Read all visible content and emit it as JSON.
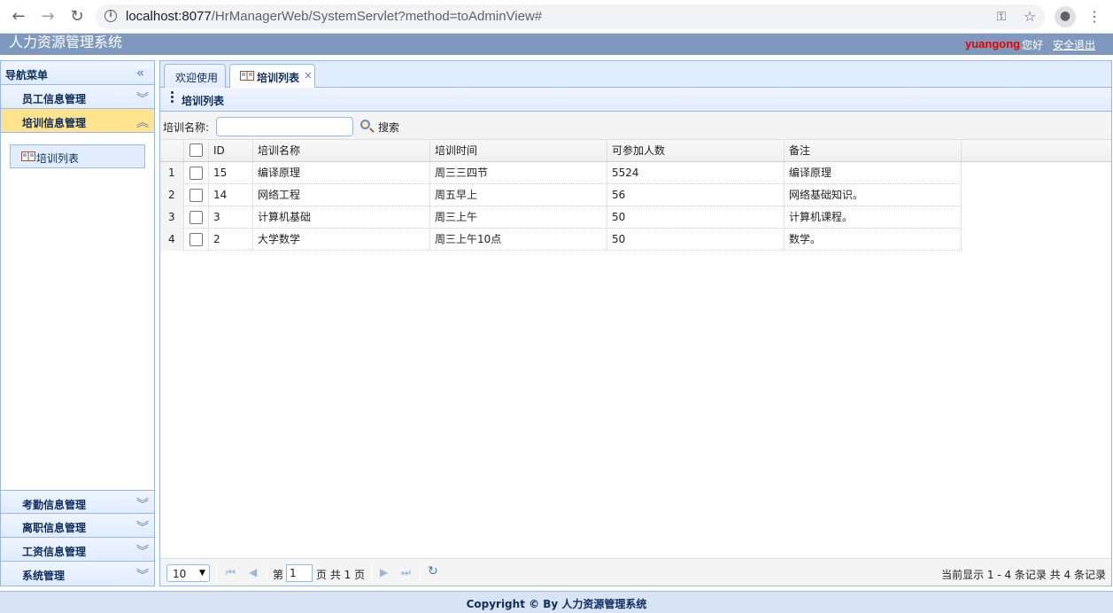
{
  "browser": {
    "url_host": "localhost:8077",
    "url_path": "/HrManagerWeb/SystemServlet?method=toAdminView#"
  },
  "app": {
    "title": "人力资源管理系统",
    "username": "yuangong",
    "greeting": "您好",
    "logout": "安全退出"
  },
  "sidebar": {
    "title": "导航菜单",
    "sections": [
      {
        "label": "员工信息管理",
        "active": false
      },
      {
        "label": "培训信息管理",
        "active": true
      },
      {
        "label": "考勤信息管理",
        "active": false
      },
      {
        "label": "离职信息管理",
        "active": false
      },
      {
        "label": "工资信息管理",
        "active": false
      },
      {
        "label": "系统管理",
        "active": false
      }
    ],
    "active_link": "培训列表"
  },
  "tabs": [
    {
      "label": "欢迎使用",
      "selected": false
    },
    {
      "label": "培训列表",
      "selected": true
    }
  ],
  "panel": {
    "title": "培训列表",
    "search_label": "培训名称:",
    "search_value": "",
    "search_button": "搜索"
  },
  "grid": {
    "columns": [
      "ID",
      "培训名称",
      "培训时间",
      "可参加人数",
      "备注"
    ],
    "rows": [
      {
        "rn": "1",
        "id": "15",
        "name": "编译原理",
        "time": "周三三四节",
        "count": "5524",
        "note": "编译原理"
      },
      {
        "rn": "2",
        "id": "14",
        "name": "网络工程",
        "time": "周五早上",
        "count": "56",
        "note": "网络基础知识。"
      },
      {
        "rn": "3",
        "id": "3",
        "name": "计算机基础",
        "time": "周三上午",
        "count": "50",
        "note": "计算机课程。"
      },
      {
        "rn": "4",
        "id": "2",
        "name": "大学数学",
        "time": "周三上午10点",
        "count": "50",
        "note": "数学。"
      }
    ]
  },
  "pager": {
    "page_size": "10",
    "page_prefix": "第",
    "page": "1",
    "page_total": "页 共 1 页",
    "info": "当前显示 1 - 4 条记录 共 4 条记录"
  },
  "footer": {
    "text": "Copyright © By 人力资源管理系统"
  }
}
